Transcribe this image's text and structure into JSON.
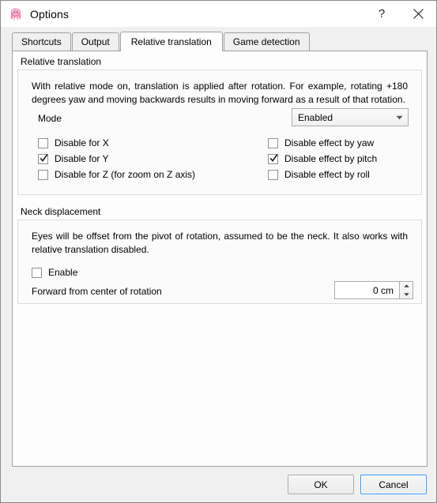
{
  "window": {
    "title": "Options",
    "icon": "octopus-icon",
    "help_label": "?",
    "close_label": "×"
  },
  "tabs": [
    {
      "label": "Shortcuts",
      "selected": false
    },
    {
      "label": "Output",
      "selected": false
    },
    {
      "label": "Relative translation",
      "selected": true
    },
    {
      "label": "Game detection",
      "selected": false
    }
  ],
  "relative_translation": {
    "group_title": "Relative translation",
    "description": "With relative mode on, translation is applied after rotation. For example, rotating +180 degrees yaw and moving backwards results in moving forward as a result of that rotation.",
    "mode_label": "Mode",
    "mode_value": "Enabled",
    "mode_options": [
      "Enabled"
    ],
    "checkboxes_left": [
      {
        "label": "Disable for X",
        "checked": false
      },
      {
        "label": "Disable for Y",
        "checked": true
      },
      {
        "label": "Disable for Z (for zoom on Z axis)",
        "checked": false
      }
    ],
    "checkboxes_right": [
      {
        "label": "Disable effect by yaw",
        "checked": false
      },
      {
        "label": "Disable effect by pitch",
        "checked": true
      },
      {
        "label": "Disable effect by roll",
        "checked": false
      }
    ]
  },
  "neck_displacement": {
    "group_title": "Neck displacement",
    "description": "Eyes will be offset from the pivot of rotation, assumed to be the neck. It also works with relative translation disabled.",
    "enable_label": "Enable",
    "enable_checked": false,
    "forward_label": "Forward from center of rotation",
    "forward_value": "0 cm"
  },
  "footer": {
    "ok_label": "OK",
    "cancel_label": "Cancel"
  },
  "colors": {
    "accent": "#3399ff",
    "window_bg": "#f0f0f0",
    "panel_bg": "#fdfdfd",
    "group_bg": "#fbfbfb",
    "border": "#a0a0a0"
  }
}
